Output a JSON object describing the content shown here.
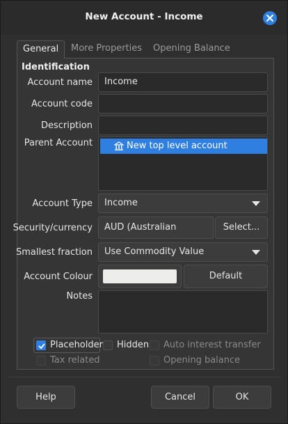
{
  "window": {
    "title": "New Account - Income"
  },
  "tabs": [
    {
      "label": "General",
      "active": true
    },
    {
      "label": "More Properties",
      "active": false
    },
    {
      "label": "Opening Balance",
      "active": false
    }
  ],
  "identification": {
    "section_title": "Identification",
    "account_name": {
      "label": "Account name",
      "value": "Income"
    },
    "account_code": {
      "label": "Account code",
      "value": ""
    },
    "description": {
      "label": "Description",
      "value": ""
    },
    "parent_account": {
      "label": "Parent Account",
      "items": [
        "New top level account"
      ],
      "icon": "bank-icon"
    },
    "account_type": {
      "label": "Account Type",
      "value": "Income"
    },
    "security": {
      "label": "Security/currency",
      "value": "AUD (Australian Dollar)",
      "select_label": "Select..."
    },
    "smallest_fraction": {
      "label": "Smallest fraction",
      "value": "Use Commodity Value"
    },
    "account_colour": {
      "label": "Account Colour",
      "swatch": "#ededeb",
      "default_label": "Default"
    },
    "notes": {
      "label": "Notes",
      "value": ""
    }
  },
  "checkboxes": {
    "placeholder": {
      "label": "Placeholder",
      "checked": true,
      "enabled": true
    },
    "hidden": {
      "label": "Hidden",
      "checked": false,
      "enabled": true
    },
    "auto_interest": {
      "label": "Auto interest transfer",
      "checked": false,
      "enabled": false
    },
    "tax_related": {
      "label": "Tax related",
      "checked": false,
      "enabled": false
    },
    "opening_balance": {
      "label": "Opening balance",
      "checked": false,
      "enabled": false
    }
  },
  "buttons": {
    "help": "Help",
    "cancel": "Cancel",
    "ok": "OK"
  },
  "colors": {
    "accent": "#2f7fe0",
    "background": "#2f2f2f"
  }
}
